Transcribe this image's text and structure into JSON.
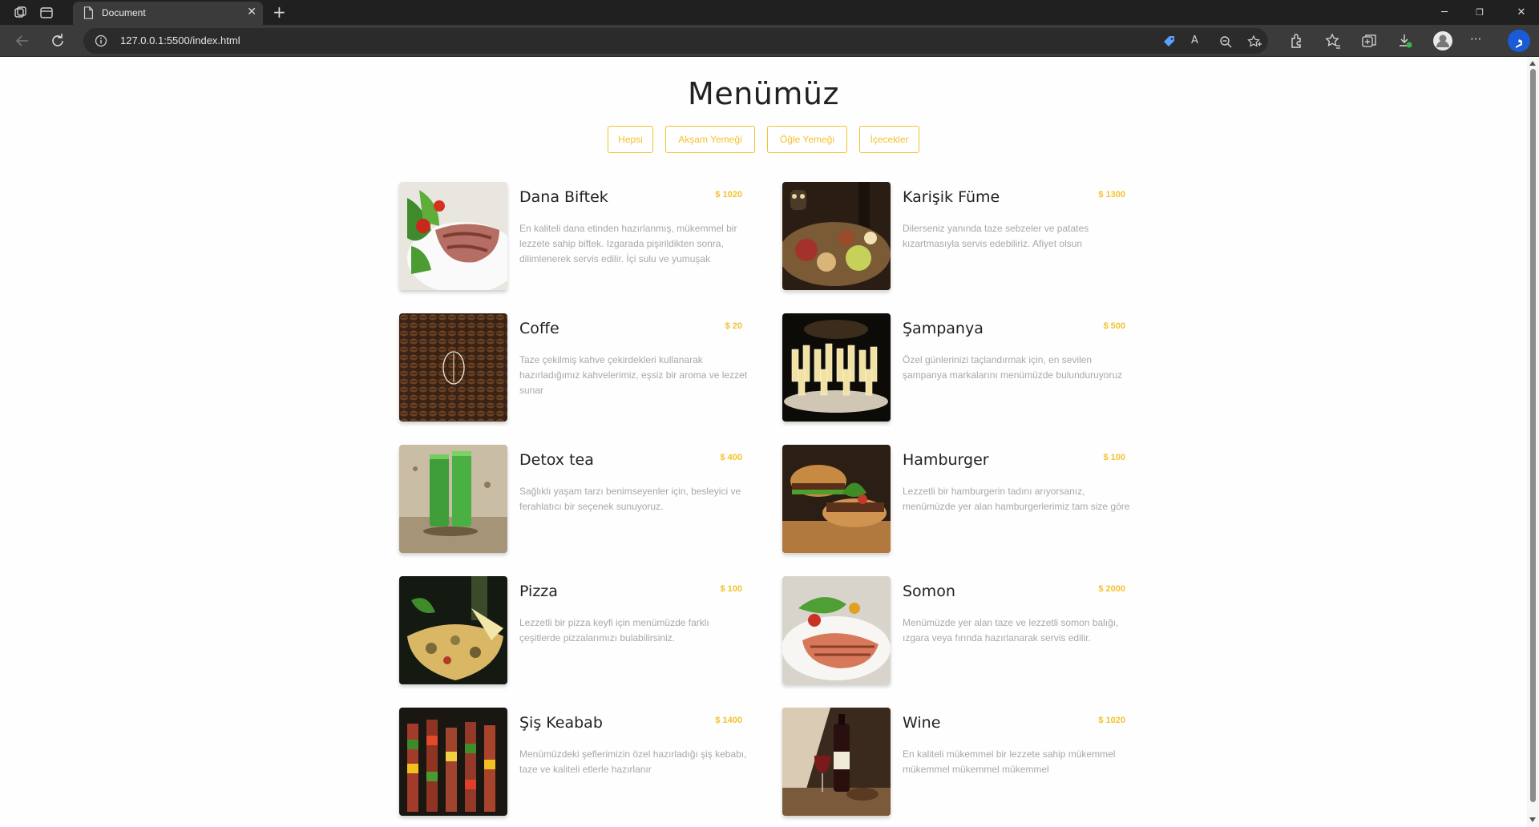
{
  "browser": {
    "tab_title": "Document",
    "new_tab_label": "+",
    "url": "127.0.0.1:5500/index.html",
    "window_controls": [
      "minimize-icon",
      "restore-icon",
      "close-icon"
    ],
    "toolbar_icons": [
      "shopping-tag-icon",
      "read-aloud-icon",
      "zoom-icon",
      "favorite-add-icon",
      "extensions-icon",
      "favorites-icon",
      "collections-icon",
      "downloads-icon",
      "profile-icon",
      "more-icon",
      "bing-chat-icon"
    ]
  },
  "page": {
    "title": "Menümüz",
    "filters": [
      "Hepsi",
      "Akşam Yemeği",
      "Öğle Yemeği",
      "İçecekler"
    ],
    "accent_color": "#f2c230"
  },
  "menu": [
    {
      "name": "Dana Biftek",
      "price": "$ 1020",
      "desc": "En kaliteli dana etinden hazırlanmış, mükemmel bir lezzete sahip biftek. Izgarada pişirildikten sonra, dilimlenerek servis edilir. İçi sulu ve yumuşak",
      "image": "steak-salad"
    },
    {
      "name": "Karişik Füme",
      "price": "$ 1300",
      "desc": "Dilerseniz yanında taze sebzeler ve patates kızartmasıyla servis edebiliriz. Afiyet olsun",
      "image": "smoked-platter"
    },
    {
      "name": "Coffe",
      "price": "$ 20",
      "desc": "Taze çekilmiş kahve çekirdekleri kullanarak hazırladığımız kahvelerimiz, eşsiz bir aroma ve lezzet sunar",
      "image": "coffee-beans"
    },
    {
      "name": "Şampanya",
      "price": "$ 500",
      "desc": "Özel günlerinizi taçlandırmak için, en sevilen şampanya markalarını menümüzde bulunduruyoruz",
      "image": "champagne-glasses"
    },
    {
      "name": "Detox tea",
      "price": "$ 400",
      "desc": "Sağlıklı yaşam tarzı benimseyenler için, besleyici ve ferahlatıcı bir seçenek sunuyoruz.",
      "image": "green-detox"
    },
    {
      "name": "Hamburger",
      "price": "$ 100",
      "desc": "Lezzetli bir hamburgerin tadını arıyorsanız, menümüzde yer alan hamburgerlerimiz tam size göre",
      "image": "burger"
    },
    {
      "name": "Pizza",
      "price": "$ 100",
      "desc": "Lezzetli bir pizza keyfi için menümüzde farklı çeşitlerde pizzalarımızı bulabilirsiniz.",
      "image": "pizza"
    },
    {
      "name": "Somon",
      "price": "$ 2000",
      "desc": "Menümüzde yer alan taze ve lezzetli somon balığı, ızgara veya fırında hazırlanarak servis edilir.",
      "image": "salmon"
    },
    {
      "name": "Şiş Keabab",
      "price": "$ 1400",
      "desc": "Menümüzdeki şeflerimizin özel hazırladığı şiş kebabı, taze ve kaliteli etlerle hazırlanır",
      "image": "kebab"
    },
    {
      "name": "Wine",
      "price": "$ 1020",
      "desc": "En kaliteli mükemmel bir lezzete sahip mükemmel mükemmel mükemmel mükemmel",
      "image": "wine"
    }
  ]
}
